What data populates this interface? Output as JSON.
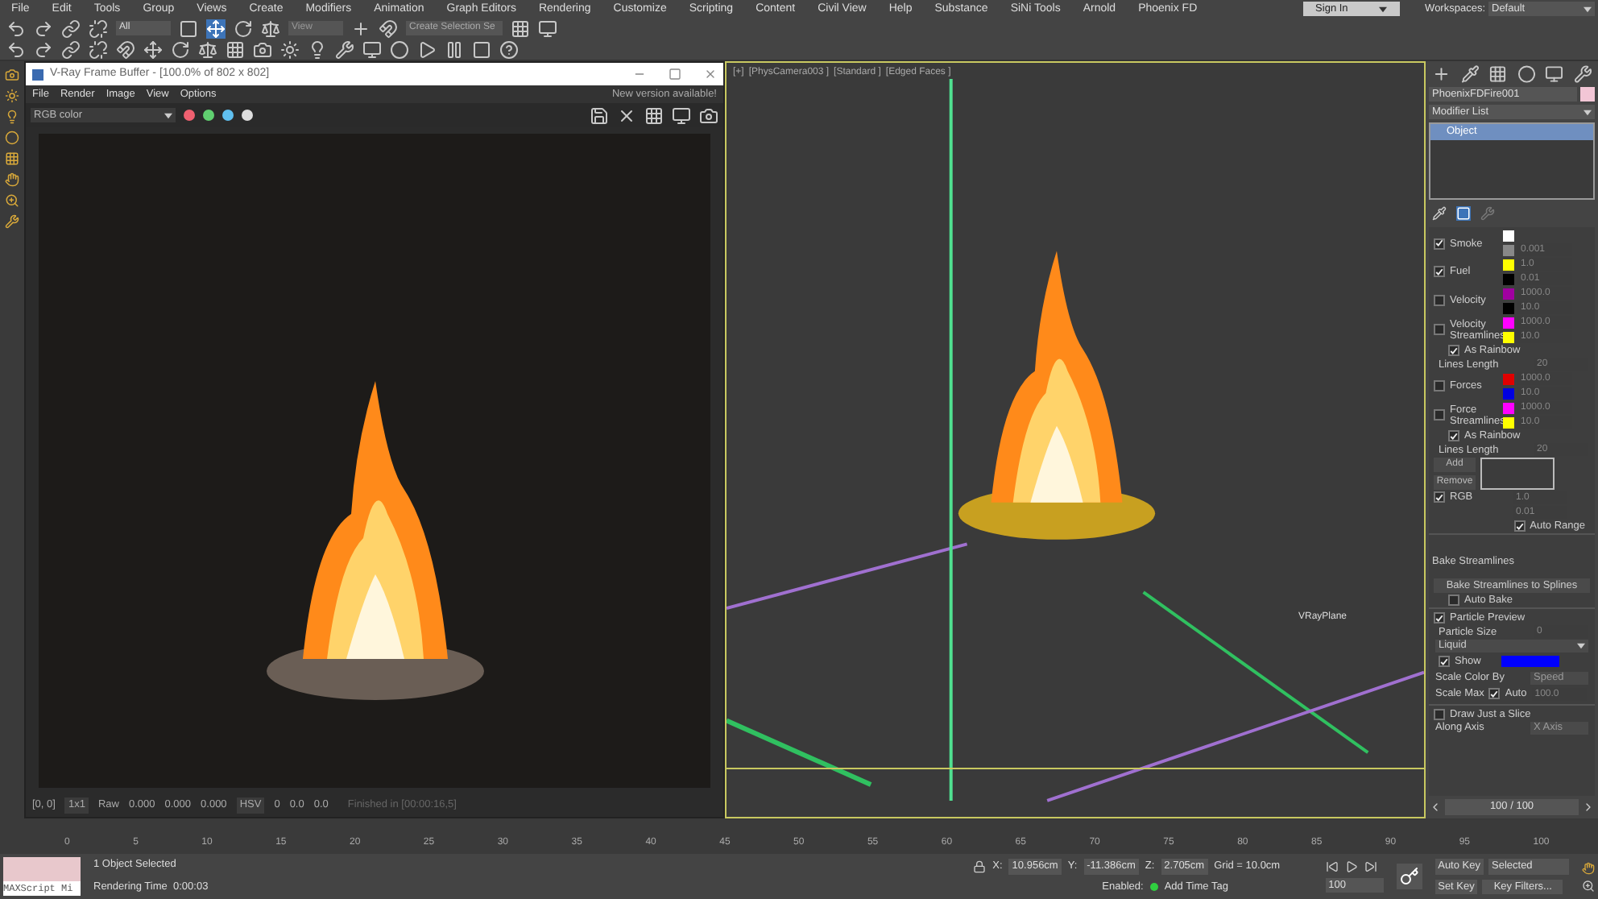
{
  "menu": [
    "File",
    "Edit",
    "Tools",
    "Group",
    "Views",
    "Create",
    "Modifiers",
    "Animation",
    "Graph Editors",
    "Rendering",
    "Customize",
    "Scripting",
    "Content",
    "Civil View",
    "Help",
    "Substance",
    "SiNi Tools",
    "Arnold",
    "Phoenix FD"
  ],
  "toolbar": {
    "selection_filter": "All",
    "reference_coord": "View",
    "selection_set": "Create Selection Se"
  },
  "sign_in": "Sign In",
  "workspaces_label": "Workspaces:",
  "workspace": "Default",
  "vfb": {
    "title": "V-Ray Frame Buffer - [100.0% of 802 x 802]",
    "menu": [
      "File",
      "Render",
      "Image",
      "View",
      "Options"
    ],
    "notice": "New version available!",
    "channel": "RGB color",
    "status": {
      "coords": "[0, 0]",
      "zoom": "1x1",
      "raw": "Raw",
      "values": [
        "0.000",
        "0.000",
        "0.000"
      ],
      "mode": "HSV",
      "hsv": [
        "0",
        "0.0",
        "0.0"
      ],
      "finished": "Finished in [00:00:16,5]"
    }
  },
  "viewport": {
    "labels": [
      "[+]",
      "[PhysCamera003 ]",
      "[Standard ]",
      "[Edged Faces ]"
    ],
    "plane_label": "VRayPlane"
  },
  "command_panel": {
    "object_name": "PhoenixFDFire001",
    "modifier_list": "Modifier List",
    "stack": [
      {
        "label": "Object",
        "selected": true
      }
    ],
    "rows": [
      {
        "kind": "channel",
        "label": "Smoke",
        "checked": true,
        "swatches": [
          {
            "color": "#ffffff"
          },
          {
            "color": "#888888",
            "value": "0.001"
          }
        ]
      },
      {
        "kind": "channel",
        "label": "Fuel",
        "checked": true,
        "swatches": [
          {
            "color": "#ffff00",
            "value": "1.0"
          },
          {
            "color": "#000000",
            "value": "0.01"
          }
        ]
      },
      {
        "kind": "channel",
        "label": "Velocity",
        "checked": false,
        "swatches": [
          {
            "color": "#a000a0",
            "value": "1000.0"
          },
          {
            "color": "#000000",
            "value": "10.0"
          }
        ]
      },
      {
        "kind": "channel",
        "label": "Velocity Streamlines",
        "checked": false,
        "swatches": [
          {
            "color": "#ff00ff",
            "value": "1000.0"
          },
          {
            "color": "#ffff00",
            "value": "10.0"
          }
        ]
      },
      {
        "kind": "check",
        "label": "As Rainbow",
        "checked": true
      },
      {
        "kind": "spinner",
        "label": "Lines Length",
        "value": "20"
      },
      {
        "kind": "channel",
        "label": "Forces",
        "checked": false,
        "swatches": [
          {
            "color": "#e00000",
            "value": "1000.0"
          },
          {
            "color": "#0000e0",
            "value": "10.0"
          }
        ]
      },
      {
        "kind": "channel",
        "label": "Force Streamlines",
        "checked": false,
        "swatches": [
          {
            "color": "#ff00ff",
            "value": "1000.0"
          },
          {
            "color": "#ffff00",
            "value": "10.0"
          }
        ]
      },
      {
        "kind": "check",
        "label": "As Rainbow",
        "checked": true
      },
      {
        "kind": "spinner",
        "label": "Lines Length",
        "value": "20"
      },
      {
        "kind": "addremove",
        "add": "Add",
        "remove": "Remove"
      },
      {
        "kind": "rgb",
        "label": "RGB",
        "checked": true,
        "values": [
          "1.0",
          "0.01"
        ]
      },
      {
        "kind": "check_right",
        "label": "Auto Range",
        "checked": true
      },
      {
        "kind": "header",
        "label": "Bake Streamlines"
      },
      {
        "kind": "button",
        "label": "Bake Streamlines to Splines"
      },
      {
        "kind": "check",
        "label": "Auto Bake",
        "checked": false
      },
      {
        "kind": "header_check",
        "label": "Particle Preview",
        "checked": true
      },
      {
        "kind": "spinner",
        "label": "Particle Size",
        "value": "0"
      },
      {
        "kind": "dropdown",
        "value": "Liquid"
      },
      {
        "kind": "show",
        "label": "Show",
        "checked": true,
        "color": "#0000ff"
      },
      {
        "kind": "labeled_dropdown",
        "label": "Scale Color By",
        "value": "Speed"
      },
      {
        "kind": "scale_max",
        "label": "Scale Max",
        "auto_label": "Auto",
        "checked": true,
        "value": "100.0"
      },
      {
        "kind": "header_check",
        "label": "Draw Just a Slice",
        "checked": false
      },
      {
        "kind": "labeled_dropdown",
        "label": "Along Axis",
        "value": "X Axis"
      }
    ],
    "page": "100 / 100"
  },
  "timeline": {
    "ticks": [
      "0",
      "5",
      "10",
      "15",
      "20",
      "25",
      "30",
      "35",
      "40",
      "45",
      "50",
      "55",
      "60",
      "65",
      "70",
      "75",
      "80",
      "85",
      "90",
      "95",
      "100"
    ]
  },
  "status": {
    "maxscript": "MAXScript Mi",
    "selected": "1 Object Selected",
    "render_time": "Rendering Time  0:00:03",
    "x_label": "X:",
    "x": "10.956cm",
    "y_label": "Y:",
    "y": "-11.386cm",
    "z_label": "Z:",
    "z": "2.705cm",
    "grid": "Grid = 10.0cm",
    "enabled": "Enabled:",
    "add_time_tag": "Add Time Tag",
    "auto_key": "Auto Key",
    "key_mode": "Selected",
    "set_key": "Set Key",
    "key_filters": "Key Filters...",
    "frame": "100"
  }
}
